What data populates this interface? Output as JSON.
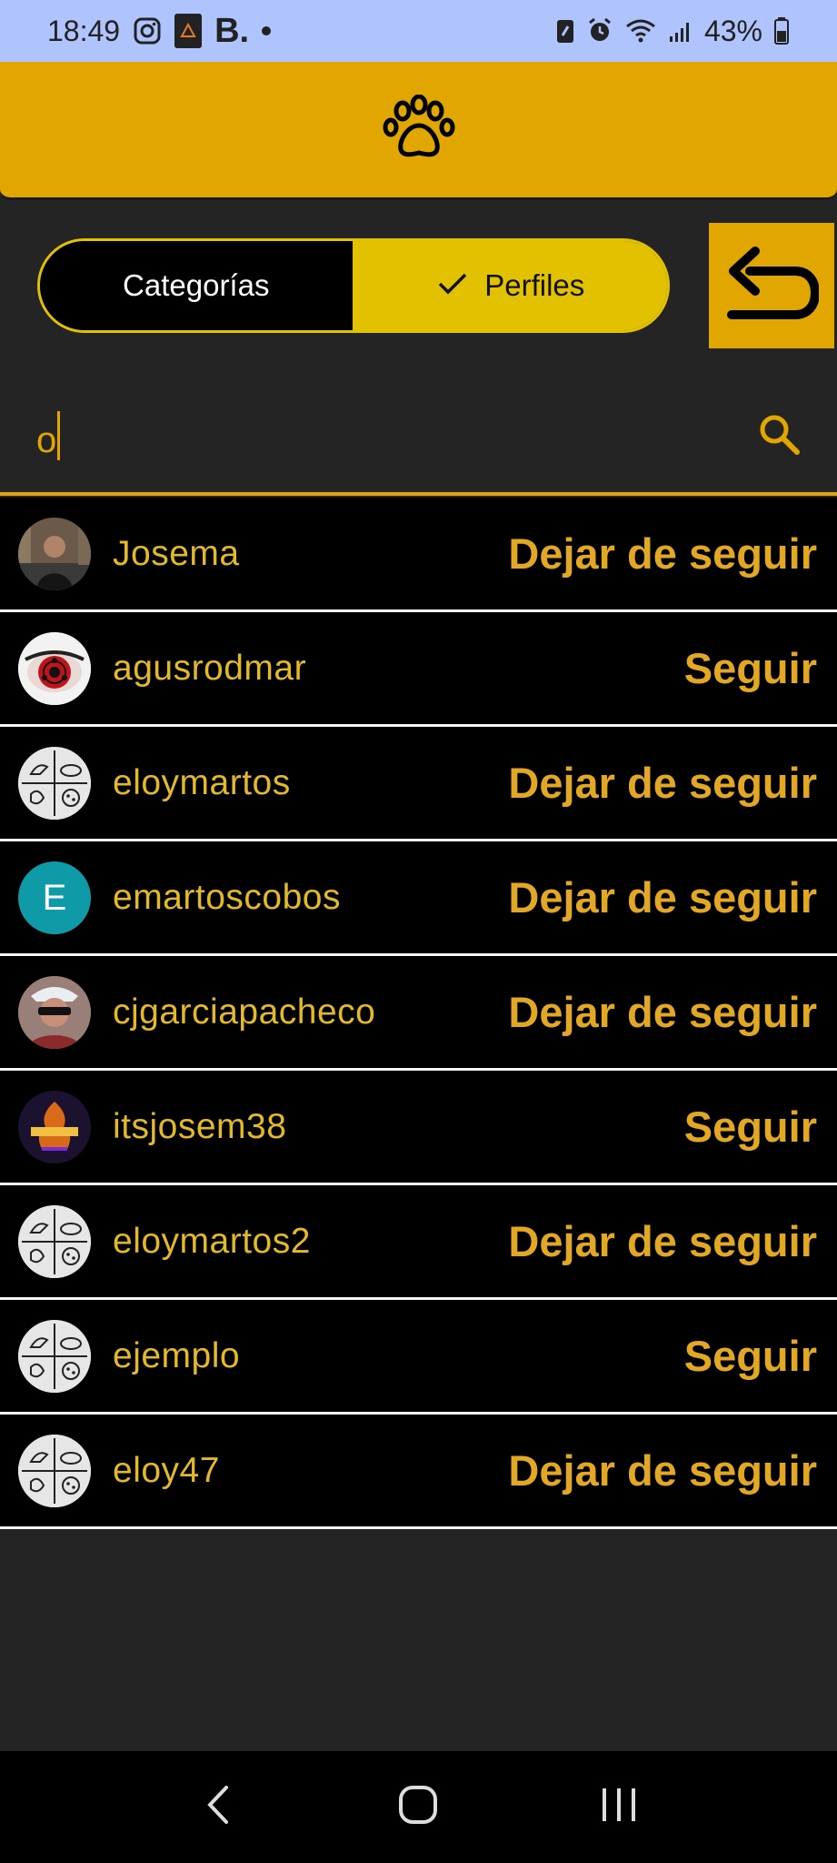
{
  "status_bar": {
    "time": "18:49",
    "battery": "43%",
    "brand_letter": "B."
  },
  "header": {
    "icon": "paw-icon"
  },
  "tabs": {
    "categories_label": "Categorías",
    "profiles_label": "Perfiles",
    "active": "profiles"
  },
  "search": {
    "value": "o"
  },
  "profiles": [
    {
      "name": "Josema",
      "action": "Dejar de seguir",
      "avatar": "photo"
    },
    {
      "name": "agusrodmar",
      "action": "Seguir",
      "avatar": "sharingan"
    },
    {
      "name": "eloymartos",
      "action": "Dejar de seguir",
      "avatar": "animals"
    },
    {
      "name": "emartoscobos",
      "action": "Dejar de seguir",
      "avatar": "letter",
      "initial": "E"
    },
    {
      "name": "cjgarciapacheco",
      "action": "Dejar de seguir",
      "avatar": "photo2"
    },
    {
      "name": "itsjosem38",
      "action": "Seguir",
      "avatar": "logo"
    },
    {
      "name": "eloymartos2",
      "action": "Dejar de seguir",
      "avatar": "animals"
    },
    {
      "name": "ejemplo",
      "action": "Seguir",
      "avatar": "animals"
    },
    {
      "name": "eloy47",
      "action": "Dejar de seguir",
      "avatar": "animals"
    }
  ],
  "colors": {
    "accent": "#e2a600",
    "segment_active": "#e2c200",
    "background": "#242424",
    "list_background": "#000000",
    "status_bar": "#afc3fc",
    "text_accent": "#e3b928"
  }
}
